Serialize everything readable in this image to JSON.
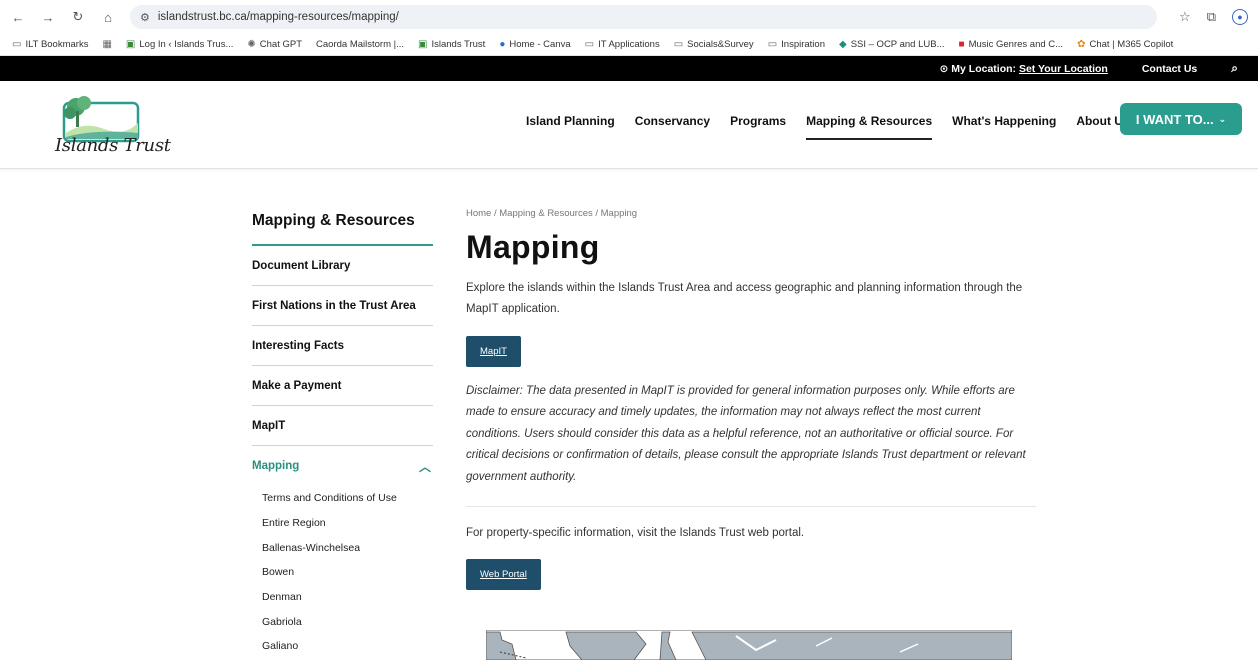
{
  "browser": {
    "url": "islandstrust.bc.ca/mapping-resources/mapping/",
    "bookmarks": [
      {
        "label": "ILT Bookmarks",
        "icon": "folder-icon"
      },
      {
        "label": "Log In ‹ Islands Trus...",
        "icon": "site-icon"
      },
      {
        "label": "Chat GPT",
        "icon": "chatgpt-icon"
      },
      {
        "label": "Caorda Mailstorm |...",
        "icon": "site-icon"
      },
      {
        "label": "Islands Trust",
        "icon": "site-icon"
      },
      {
        "label": "Home - Canva",
        "icon": "canva-icon"
      },
      {
        "label": "IT Applications",
        "icon": "folder-icon"
      },
      {
        "label": "Socials&Survey",
        "icon": "folder-icon"
      },
      {
        "label": "Inspiration",
        "icon": "folder-icon"
      },
      {
        "label": "SSI – OCP and LUB...",
        "icon": "site-icon"
      },
      {
        "label": "Music Genres and C...",
        "icon": "music-icon"
      },
      {
        "label": "Chat | M365 Copilot",
        "icon": "copilot-icon"
      }
    ]
  },
  "utility": {
    "location_label": "My Location:",
    "location_link": "Set Your Location",
    "contact": "Contact Us"
  },
  "header": {
    "logo_text": "Islands Trust",
    "nav": [
      "Island Planning",
      "Conservancy",
      "Programs",
      "Mapping & Resources",
      "What's Happening",
      "About Us"
    ],
    "cta": "I WANT TO..."
  },
  "sidebar": {
    "title": "Mapping & Resources",
    "items": [
      "Document Library",
      "First Nations in the Trust Area",
      "Interesting Facts",
      "Make a Payment",
      "MapIT"
    ],
    "active": "Mapping",
    "sub_items": [
      "Terms and Conditions of Use",
      "Entire Region",
      "Ballenas-Winchelsea",
      "Bowen",
      "Denman",
      "Gabriola",
      "Galiano"
    ]
  },
  "content": {
    "breadcrumb": "Home / Mapping & Resources / Mapping",
    "title": "Mapping",
    "intro": "Explore the islands within the Islands Trust Area and access geographic and planning information through the MapIT application.",
    "mapit_button": "MapIT",
    "disclaimer": "Disclaimer: The data presented in MapIT is provided for general information purposes only. While efforts are made to ensure accuracy and timely updates, the information may not always reflect the most current conditions. Users should consider this data as a helpful reference, not an authoritative or official source. For critical decisions or confirmation of details, please consult the appropriate Islands Trust department or relevant government authority.",
    "portal_text": "For property-specific information, visit the Islands Trust web portal.",
    "portal_button": "Web Portal"
  },
  "colors": {
    "accent": "#2a9d8f",
    "button": "#1f4e6b",
    "map_land": "#a9b4bd"
  }
}
